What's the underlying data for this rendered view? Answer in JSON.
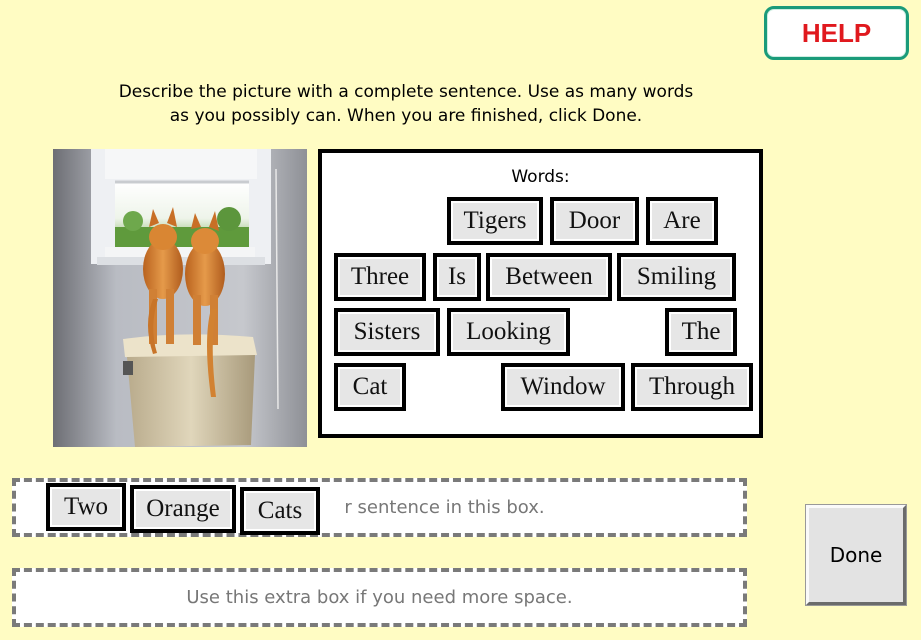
{
  "help_button": {
    "label": "HELP"
  },
  "instructions": {
    "line1": "Describe the picture with a complete sentence. Use as many words",
    "line2": "as you possibly can. When you are finished, click Done."
  },
  "photo": {
    "subject": "two orange cats on a toilet tank looking out a window"
  },
  "word_bank": {
    "title": "Words:",
    "words": [
      "Tigers",
      "Door",
      "Are",
      "Three",
      "Is",
      "Between",
      "Smiling",
      "Sisters",
      "Looking",
      "The",
      "Cat",
      "Window",
      "Through"
    ]
  },
  "sentence_box": {
    "placeholder": "Put your sentence in this box.",
    "visible_placeholder": "r sentence in this box.",
    "placed_words": [
      "Two",
      "Orange",
      "Cats"
    ]
  },
  "extra_box": {
    "placeholder": "Use this extra box if you need more space."
  },
  "done_button": {
    "label": "Done"
  },
  "colors": {
    "background": "#fffcc3",
    "help_text": "#e0191e",
    "help_border": "#1a9b7a",
    "tile_fill": "#e6e6e6"
  }
}
